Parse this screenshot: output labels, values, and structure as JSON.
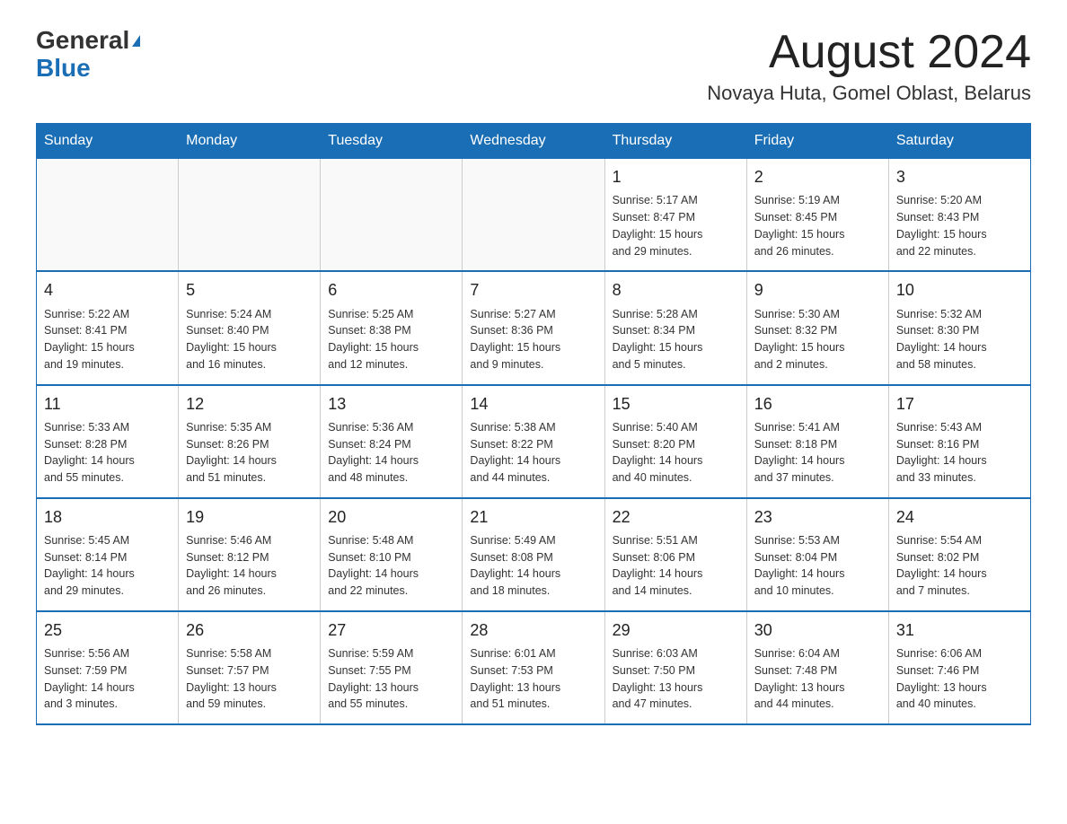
{
  "logo": {
    "text_general": "General",
    "text_blue": "Blue",
    "triangle_symbol": "▲"
  },
  "header": {
    "month_year": "August 2024",
    "location": "Novaya Huta, Gomel Oblast, Belarus"
  },
  "weekdays": [
    "Sunday",
    "Monday",
    "Tuesday",
    "Wednesday",
    "Thursday",
    "Friday",
    "Saturday"
  ],
  "weeks": [
    [
      {
        "day": "",
        "info": ""
      },
      {
        "day": "",
        "info": ""
      },
      {
        "day": "",
        "info": ""
      },
      {
        "day": "",
        "info": ""
      },
      {
        "day": "1",
        "info": "Sunrise: 5:17 AM\nSunset: 8:47 PM\nDaylight: 15 hours\nand 29 minutes."
      },
      {
        "day": "2",
        "info": "Sunrise: 5:19 AM\nSunset: 8:45 PM\nDaylight: 15 hours\nand 26 minutes."
      },
      {
        "day": "3",
        "info": "Sunrise: 5:20 AM\nSunset: 8:43 PM\nDaylight: 15 hours\nand 22 minutes."
      }
    ],
    [
      {
        "day": "4",
        "info": "Sunrise: 5:22 AM\nSunset: 8:41 PM\nDaylight: 15 hours\nand 19 minutes."
      },
      {
        "day": "5",
        "info": "Sunrise: 5:24 AM\nSunset: 8:40 PM\nDaylight: 15 hours\nand 16 minutes."
      },
      {
        "day": "6",
        "info": "Sunrise: 5:25 AM\nSunset: 8:38 PM\nDaylight: 15 hours\nand 12 minutes."
      },
      {
        "day": "7",
        "info": "Sunrise: 5:27 AM\nSunset: 8:36 PM\nDaylight: 15 hours\nand 9 minutes."
      },
      {
        "day": "8",
        "info": "Sunrise: 5:28 AM\nSunset: 8:34 PM\nDaylight: 15 hours\nand 5 minutes."
      },
      {
        "day": "9",
        "info": "Sunrise: 5:30 AM\nSunset: 8:32 PM\nDaylight: 15 hours\nand 2 minutes."
      },
      {
        "day": "10",
        "info": "Sunrise: 5:32 AM\nSunset: 8:30 PM\nDaylight: 14 hours\nand 58 minutes."
      }
    ],
    [
      {
        "day": "11",
        "info": "Sunrise: 5:33 AM\nSunset: 8:28 PM\nDaylight: 14 hours\nand 55 minutes."
      },
      {
        "day": "12",
        "info": "Sunrise: 5:35 AM\nSunset: 8:26 PM\nDaylight: 14 hours\nand 51 minutes."
      },
      {
        "day": "13",
        "info": "Sunrise: 5:36 AM\nSunset: 8:24 PM\nDaylight: 14 hours\nand 48 minutes."
      },
      {
        "day": "14",
        "info": "Sunrise: 5:38 AM\nSunset: 8:22 PM\nDaylight: 14 hours\nand 44 minutes."
      },
      {
        "day": "15",
        "info": "Sunrise: 5:40 AM\nSunset: 8:20 PM\nDaylight: 14 hours\nand 40 minutes."
      },
      {
        "day": "16",
        "info": "Sunrise: 5:41 AM\nSunset: 8:18 PM\nDaylight: 14 hours\nand 37 minutes."
      },
      {
        "day": "17",
        "info": "Sunrise: 5:43 AM\nSunset: 8:16 PM\nDaylight: 14 hours\nand 33 minutes."
      }
    ],
    [
      {
        "day": "18",
        "info": "Sunrise: 5:45 AM\nSunset: 8:14 PM\nDaylight: 14 hours\nand 29 minutes."
      },
      {
        "day": "19",
        "info": "Sunrise: 5:46 AM\nSunset: 8:12 PM\nDaylight: 14 hours\nand 26 minutes."
      },
      {
        "day": "20",
        "info": "Sunrise: 5:48 AM\nSunset: 8:10 PM\nDaylight: 14 hours\nand 22 minutes."
      },
      {
        "day": "21",
        "info": "Sunrise: 5:49 AM\nSunset: 8:08 PM\nDaylight: 14 hours\nand 18 minutes."
      },
      {
        "day": "22",
        "info": "Sunrise: 5:51 AM\nSunset: 8:06 PM\nDaylight: 14 hours\nand 14 minutes."
      },
      {
        "day": "23",
        "info": "Sunrise: 5:53 AM\nSunset: 8:04 PM\nDaylight: 14 hours\nand 10 minutes."
      },
      {
        "day": "24",
        "info": "Sunrise: 5:54 AM\nSunset: 8:02 PM\nDaylight: 14 hours\nand 7 minutes."
      }
    ],
    [
      {
        "day": "25",
        "info": "Sunrise: 5:56 AM\nSunset: 7:59 PM\nDaylight: 14 hours\nand 3 minutes."
      },
      {
        "day": "26",
        "info": "Sunrise: 5:58 AM\nSunset: 7:57 PM\nDaylight: 13 hours\nand 59 minutes."
      },
      {
        "day": "27",
        "info": "Sunrise: 5:59 AM\nSunset: 7:55 PM\nDaylight: 13 hours\nand 55 minutes."
      },
      {
        "day": "28",
        "info": "Sunrise: 6:01 AM\nSunset: 7:53 PM\nDaylight: 13 hours\nand 51 minutes."
      },
      {
        "day": "29",
        "info": "Sunrise: 6:03 AM\nSunset: 7:50 PM\nDaylight: 13 hours\nand 47 minutes."
      },
      {
        "day": "30",
        "info": "Sunrise: 6:04 AM\nSunset: 7:48 PM\nDaylight: 13 hours\nand 44 minutes."
      },
      {
        "day": "31",
        "info": "Sunrise: 6:06 AM\nSunset: 7:46 PM\nDaylight: 13 hours\nand 40 minutes."
      }
    ]
  ]
}
